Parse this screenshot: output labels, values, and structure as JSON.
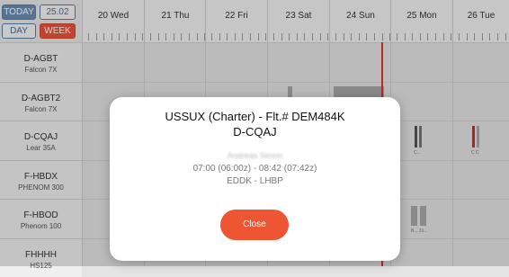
{
  "toolbar": {
    "today_label": "TODAY",
    "date_label": "25.02",
    "day_label": "DAY",
    "week_label": "WEEK"
  },
  "days": [
    "20 Wed",
    "21 Thu",
    "22 Fri",
    "23 Sat",
    "24 Sun",
    "25 Mon",
    "26 Tue"
  ],
  "aircraft": [
    {
      "reg": "D-AGBT",
      "type": "Falcon 7X"
    },
    {
      "reg": "D-AGBT2",
      "type": "Falcon 7X"
    },
    {
      "reg": "D-CQAJ",
      "type": "Lear 35A"
    },
    {
      "reg": "F-HBDX",
      "type": "PHENOM 300"
    },
    {
      "reg": "F-HBOD",
      "type": "Phenom 100"
    },
    {
      "reg": "FHHHH",
      "type": "HS125"
    }
  ],
  "mini_labels": {
    "cqaj_mon": "C...",
    "cqaj_tue": "C C",
    "hbod_mon": "B... 31.."
  },
  "modal": {
    "title": "USSUX (Charter) - Flt.# DEM484K",
    "registration": "D-CQAJ",
    "pilot": "Andreas Simon",
    "time": "07:00 (06:00z) - 08:42 (07:42z)",
    "route": "EDDK - LHBP",
    "close_label": "Close"
  },
  "colors": {
    "accent": "#ee5533",
    "today_line": "#e0332b",
    "toolbar_blue": "#6b8db3"
  }
}
